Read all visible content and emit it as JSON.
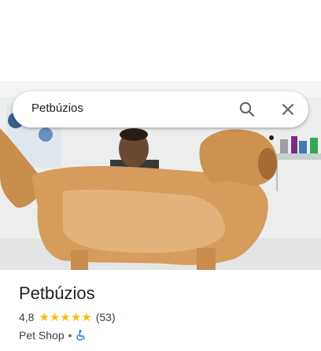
{
  "search": {
    "query": "Petbúzios"
  },
  "place": {
    "name": "Petbúzios",
    "rating": "4,8",
    "stars": 5,
    "review_count": "(53)",
    "category": "Pet Shop",
    "separator": "•",
    "accessibility_icon": "wheelchair-accessible-icon"
  },
  "colors": {
    "star": "#fbbc04",
    "accessibility": "#1a73e8",
    "text_primary": "#202124",
    "text_secondary": "#3c4043"
  },
  "icons": {
    "search": "search-icon",
    "close": "close-icon"
  }
}
